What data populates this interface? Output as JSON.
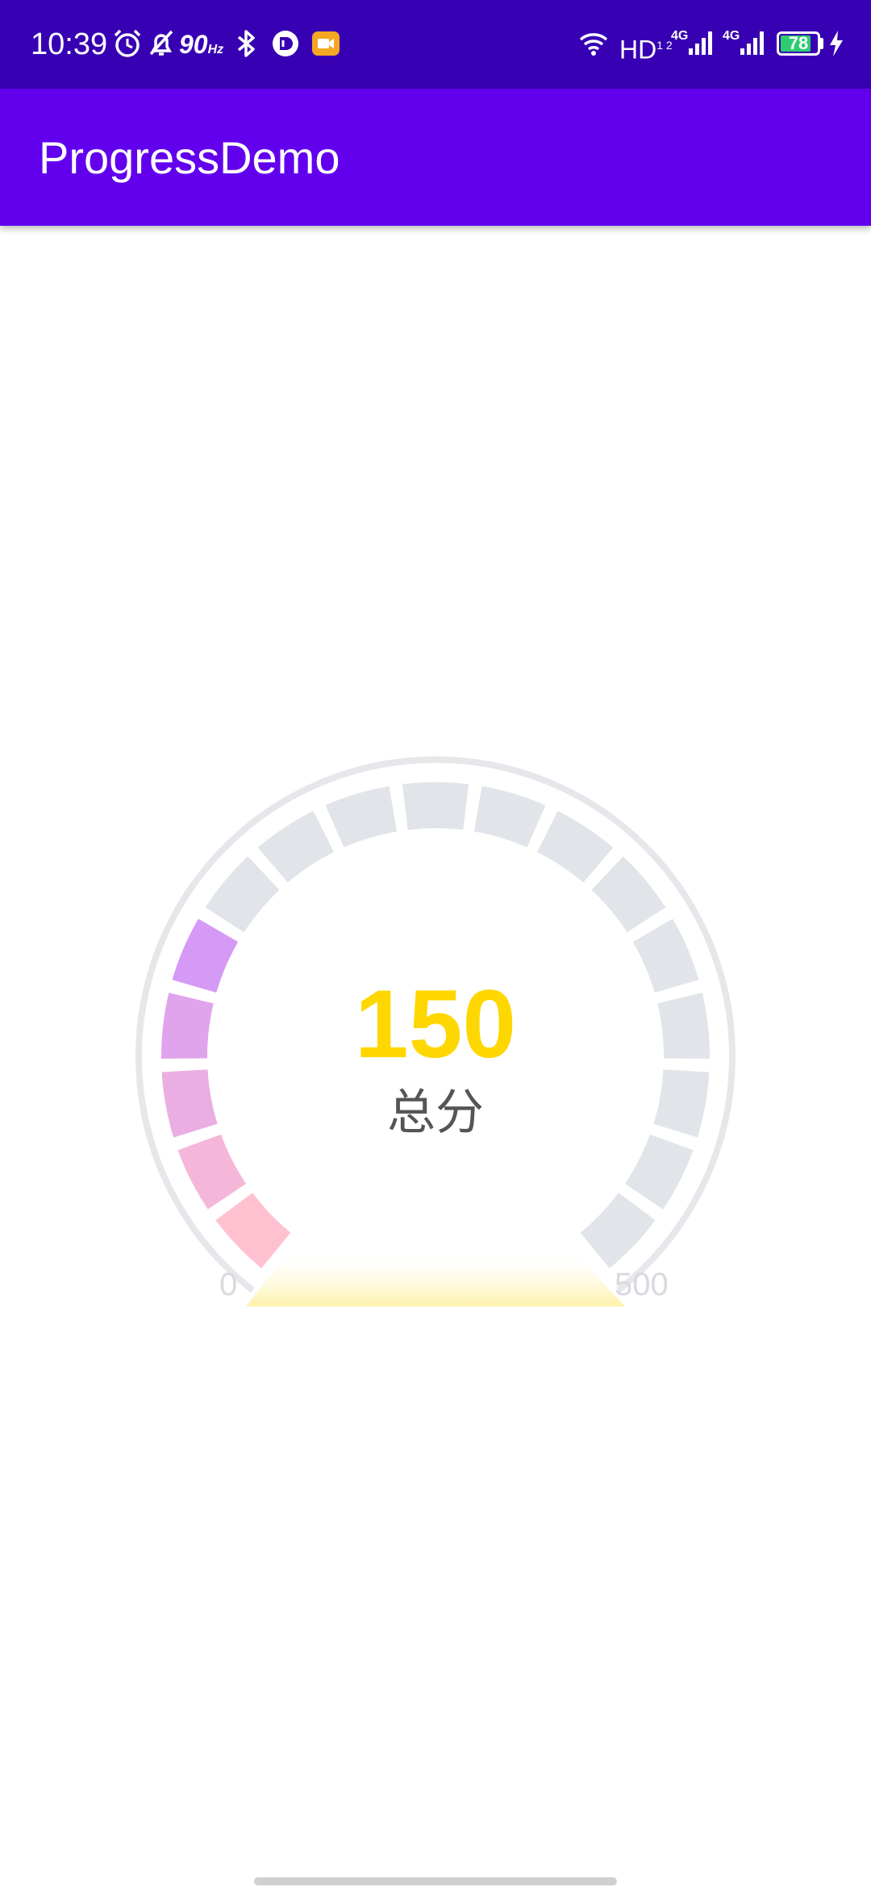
{
  "status_bar": {
    "time": "10:39",
    "refresh_rate": "90",
    "refresh_unit": "Hz",
    "network_hd": "HD",
    "network_hd_sub": "1 2",
    "signal_1_type": "4G",
    "signal_2_type": "4G",
    "battery_level": "78",
    "icons": [
      "alarm-icon",
      "dnd-off-icon",
      "bluetooth-icon",
      "cloud-app-icon",
      "video-record-icon",
      "wifi-icon",
      "signal-icon",
      "battery-icon",
      "charging-icon"
    ],
    "colors": {
      "background": "#3700B3",
      "battery_fill": "#2ecc71",
      "recording_icon": "#F5A623"
    }
  },
  "app_bar": {
    "title": "ProgressDemo",
    "color": "#6200EE"
  },
  "gauge": {
    "value": 150,
    "min": 0,
    "max": 500,
    "value_text": "150",
    "label": "总分",
    "min_label": "0",
    "max_label": "500",
    "segments_total": 17,
    "segments_filled": 5,
    "colors": {
      "value": "#FFD700",
      "inactive_segment": "#E1E4E8",
      "outer_ring": "#E6E7EB",
      "base_glow": "#FFF1A8",
      "active_gradient_start": "#FFC1D0",
      "active_gradient_end": "#D59AF5"
    }
  }
}
